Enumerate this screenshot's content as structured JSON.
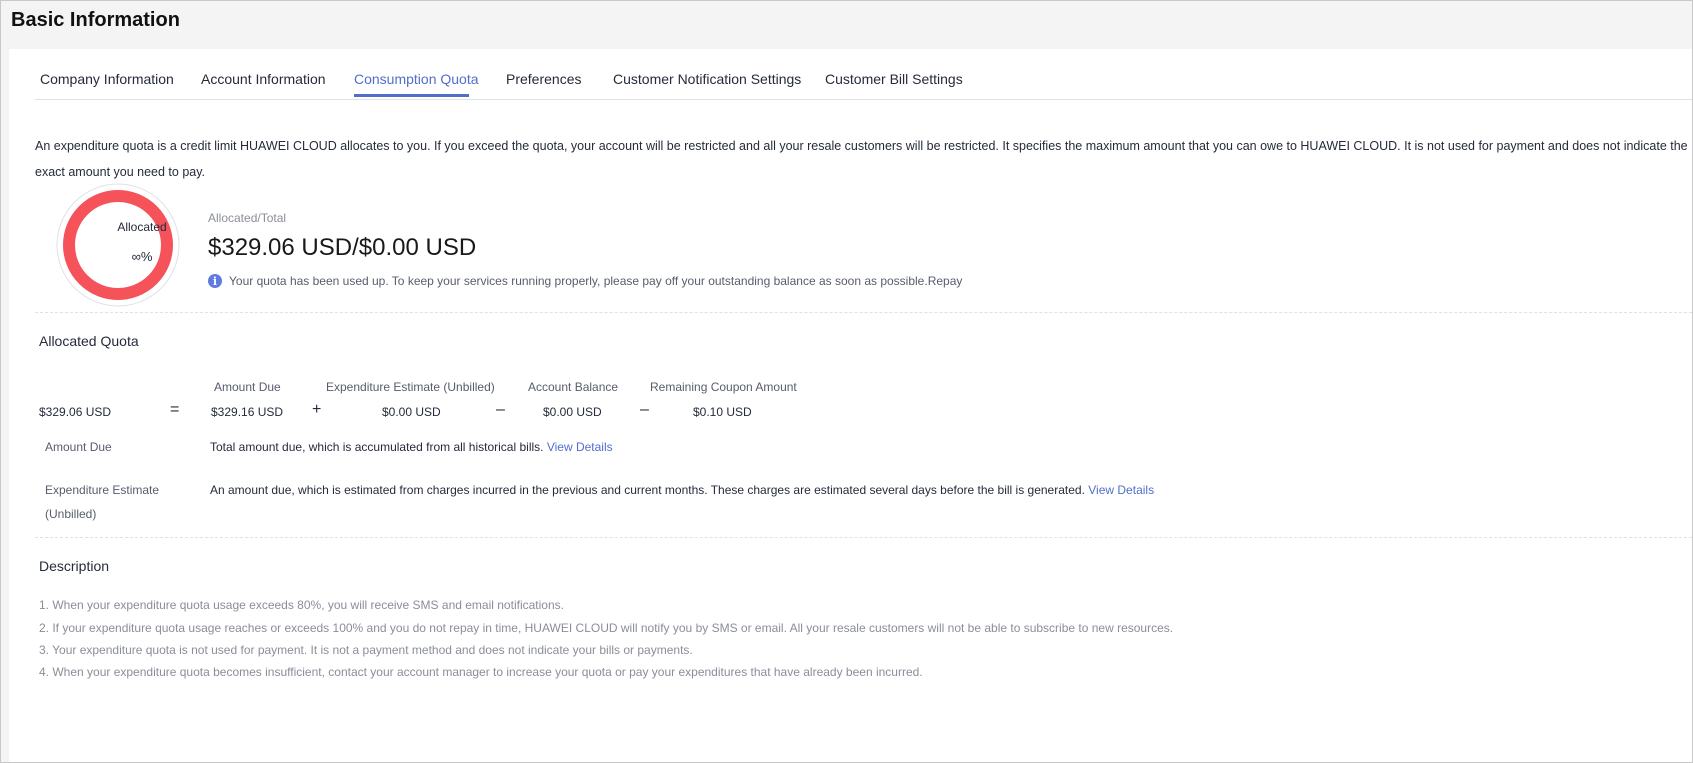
{
  "page_title": "Basic Information",
  "tabs": [
    {
      "label": "Company Information"
    },
    {
      "label": "Account Information"
    },
    {
      "label": "Consumption Quota"
    },
    {
      "label": "Preferences"
    },
    {
      "label": "Customer Notification Settings"
    },
    {
      "label": "Customer Bill Settings"
    }
  ],
  "active_tab": "Consumption Quota",
  "intro_text": "An expenditure quota is a credit limit HUAWEI CLOUD allocates to you. If you exceed the quota, your account will be restricted and all your resale customers will be restricted. It specifies the maximum amount that you can owe to HUAWEI CLOUD. It is not used for payment and does not indicate the exact amount you need to pay.",
  "donut": {
    "label": "Allocated",
    "value": "∞%",
    "usage_fraction": 1.0,
    "color": "#f5525a"
  },
  "allocation": {
    "caption": "Allocated/Total",
    "amount": "$329.06 USD/$0.00 USD",
    "warning": "Your quota has been used up. To keep your services running properly, please pay off your outstanding balance as soon as possible.",
    "repay_label": "Repay"
  },
  "allocated_quota": {
    "title": "Allocated Quota",
    "total": "$329.06 USD",
    "ops": {
      "eq": "=",
      "plus": "+",
      "minus1": "–",
      "minus2": "–"
    },
    "terms": [
      {
        "header": "Amount Due",
        "value": "$329.16 USD"
      },
      {
        "header": "Expenditure Estimate (Unbilled)",
        "value": "$0.00 USD"
      },
      {
        "header": "Account Balance",
        "value": "$0.00 USD"
      },
      {
        "header": "Remaining Coupon Amount",
        "value": "$0.10 USD"
      }
    ],
    "explanations": [
      {
        "label": "Amount Due",
        "text": "Total amount due, which is accumulated from all historical bills.",
        "link": "View Details"
      },
      {
        "label": "Expenditure Estimate (Unbilled)",
        "text": "An amount due, which is estimated from charges incurred in the previous and current months. These charges are estimated several days before the bill is generated.",
        "link": "View Details"
      }
    ]
  },
  "description": {
    "title": "Description",
    "items": [
      "1. When your expenditure quota usage exceeds 80%, you will receive SMS and email notifications.",
      "2. If your expenditure quota usage reaches or exceeds 100% and you do not repay in time, HUAWEI CLOUD will notify you by SMS or email. All your resale customers will not be able to subscribe to new resources.",
      "3. Your expenditure quota is not used for payment. It is not a payment method and does not indicate your bills or payments.",
      "4. When your expenditure quota becomes insufficient, contact your account manager to increase your quota or pay your expenditures that have already been incurred."
    ]
  },
  "colors": {
    "accent": "#526ecc",
    "danger": "#f5525a",
    "info": "#5e7ce0"
  }
}
